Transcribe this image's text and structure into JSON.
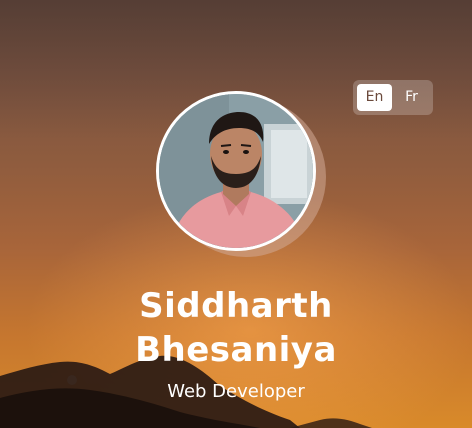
{
  "language_switcher": {
    "options": [
      {
        "label": "En",
        "active": true
      },
      {
        "label": "Fr",
        "active": false
      }
    ]
  },
  "profile": {
    "avatar_icon": "profile-photo",
    "name_line1": "Siddharth",
    "name_line2": "Bhesaniya",
    "role": "Web Developer"
  },
  "colors": {
    "text": "#ffffff",
    "switch_active_bg": "#ffffff",
    "switch_active_text": "#6b4a3c",
    "sky_top": "#6e4f41",
    "sky_bottom": "#d98a2a"
  }
}
